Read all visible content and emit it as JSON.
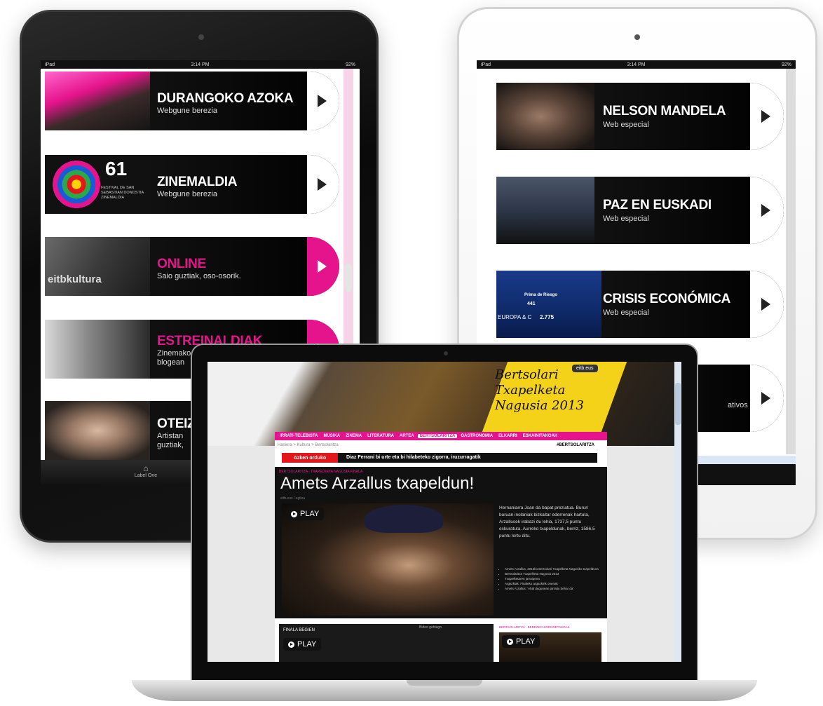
{
  "left_ipad": {
    "status": {
      "carrier": "iPad",
      "time": "3:14 PM",
      "battery": "92%"
    },
    "banners": [
      {
        "title": "DURANGOKO AZOKA",
        "subtitle": "Webgune berezia",
        "title_color": "#ffffff",
        "arrow": "white"
      },
      {
        "title": "ZINEMALDIA",
        "subtitle": "Webgune berezia",
        "title_color": "#ffffff",
        "arrow": "white",
        "logo_number": "61",
        "logo_caption": "FESTIVAL DE SAN SEBASTIAN DONOSTIA ZINEMALDIA"
      },
      {
        "title": "ONLINE",
        "subtitle": "Saio guztiak, oso-osorik.",
        "title_color": "#e6148c",
        "arrow": "pink",
        "overlay_text": "eitbkultura"
      },
      {
        "title": "ESTREINALDIAK",
        "subtitle": "Zinemako",
        "subtitle2": "blogean",
        "title_color": "#e6148c",
        "arrow": "pink"
      },
      {
        "title": "OTEIZ",
        "subtitle": "Artistan",
        "subtitle2": "guztiak,",
        "title_color": "#ffffff",
        "arrow": "none"
      }
    ],
    "tab_label": "Label One"
  },
  "right_ipad": {
    "status": {
      "carrier": "iPad",
      "time": "3:14 PM",
      "battery": "92%"
    },
    "banners": [
      {
        "title": "NELSON MANDELA",
        "subtitle": "Web especial"
      },
      {
        "title": "PAZ EN EUSKADI",
        "subtitle": "Web especial"
      },
      {
        "title": "CRISIS ECONÓMICA",
        "subtitle": "Web especial",
        "ticker": "2.775",
        "ticker_label": "EUROPA & C",
        "ticker_title": "Prima de Riesgo",
        "ticker_value": "441"
      },
      {
        "title": "",
        "subtitle": "ativos de"
      }
    ]
  },
  "laptop": {
    "hero": {
      "script_title": "Bertsolari Txapelketa Nagusia 2013",
      "chip": "eitb.eus"
    },
    "nav": [
      "IRRATI-TELEBISTA",
      "MUSIKA",
      "ZINEMA",
      "LITERATURA",
      "ARTEA",
      "BERTSOLARITZA",
      "GASTRONOMIA",
      "ELKARRI",
      "ESKAINITAKOAK"
    ],
    "nav_active": "BERTSOLARITZA",
    "breadcrumb": "Hasiera > Kultura > Bertsolaritza",
    "breadcrumb_right": "#BERTSOLARITZA",
    "alert": {
      "label": "Azken orduko",
      "text": "Diaz Ferrani bi urte eta bi hilabeteko zigorra, iruzurragatik"
    },
    "article": {
      "kicker": "BERTSOLARITZA · TXAPELKETA NAGUSIA FINALA",
      "title": "Amets Arzallus txapeldun!",
      "byline": "eitb.eus / egilea",
      "play_label": "PLAY",
      "text": "Hernaniarra Joan da bapat preziatua. Bururi buruan inolaniak bizkaitar ederrenak hartuta, Arzallusek irabazi du lehia, 1737,5 puntu eskuratuta. Aurreko txapeldunak, berriz, 1586,5 puntu lortu ditu.",
      "bullets": [
        "Amets Arzallus, 2013ko Bertsolari Txapelketa Nagusiko txapelduna",
        "Bertsolaritza Txapelketa Nagusia 2013",
        "Txapelketaren jarraipena",
        "Argazkiak: Finaleko argazkirik onenak",
        "Amets Arzallus: 'Ahal dugunean jarraitu behar da'"
      ]
    },
    "lower": {
      "label": "FINALA BEGIEN",
      "center": "Bideo gehiago",
      "play_label": "PLAY"
    },
    "lower_right": {
      "label": "BERTSOLARITZA · BEDEZKO ERRORETAKOAK",
      "play_label": "PLAY"
    }
  },
  "colors": {
    "accent": "#e6148c",
    "alert": "#e3161c",
    "hero_yellow": "#f4d21a"
  }
}
